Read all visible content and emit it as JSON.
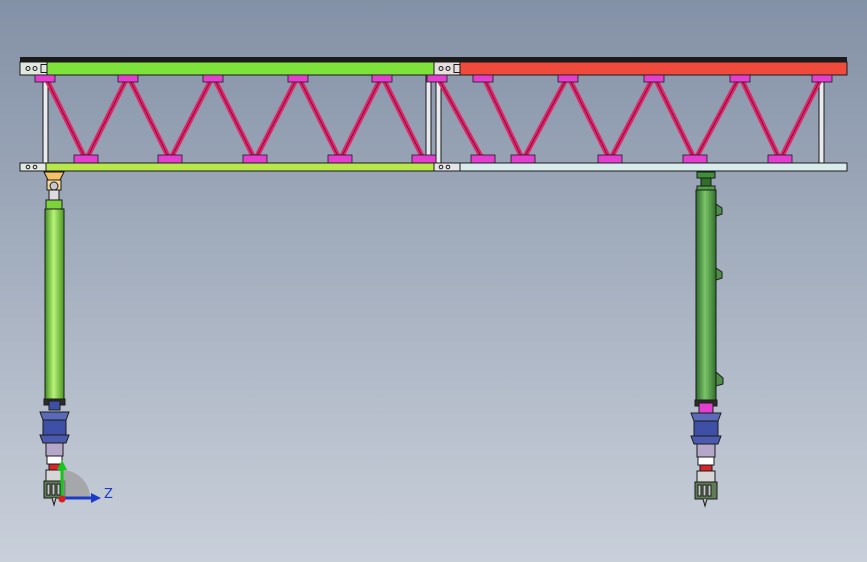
{
  "viewport": {
    "background_top": "#8391a6",
    "background_bottom": "#c9d0da"
  },
  "colors": {
    "outline": "#1b1b1b",
    "top_chord_left": "#7de23a",
    "top_chord_right": "#f04a3c",
    "bottom_chord_left": "#b8e84a",
    "bottom_chord_right": "#d8ecec",
    "truss_member": "#e0256a",
    "gusset_plate": "#e43fd0",
    "post": "#e9ebee",
    "left_column": "#7cd23a",
    "right_column": "#3f8f3a",
    "base_blue": "#3e4fa6",
    "base_lilac": "#b4a7c9",
    "base_red": "#d8262a",
    "bearing_orange": "#f4c068"
  },
  "axis_triad": {
    "z_label": "Z",
    "icons": [
      "y-axis-arrow-icon",
      "z-axis-arrow-icon",
      "x-axis-dot-icon"
    ],
    "colors": {
      "y": "#17c51f",
      "z": "#1a3cc8",
      "x": "#d81f1f",
      "arc": "#9a9a9a"
    }
  }
}
